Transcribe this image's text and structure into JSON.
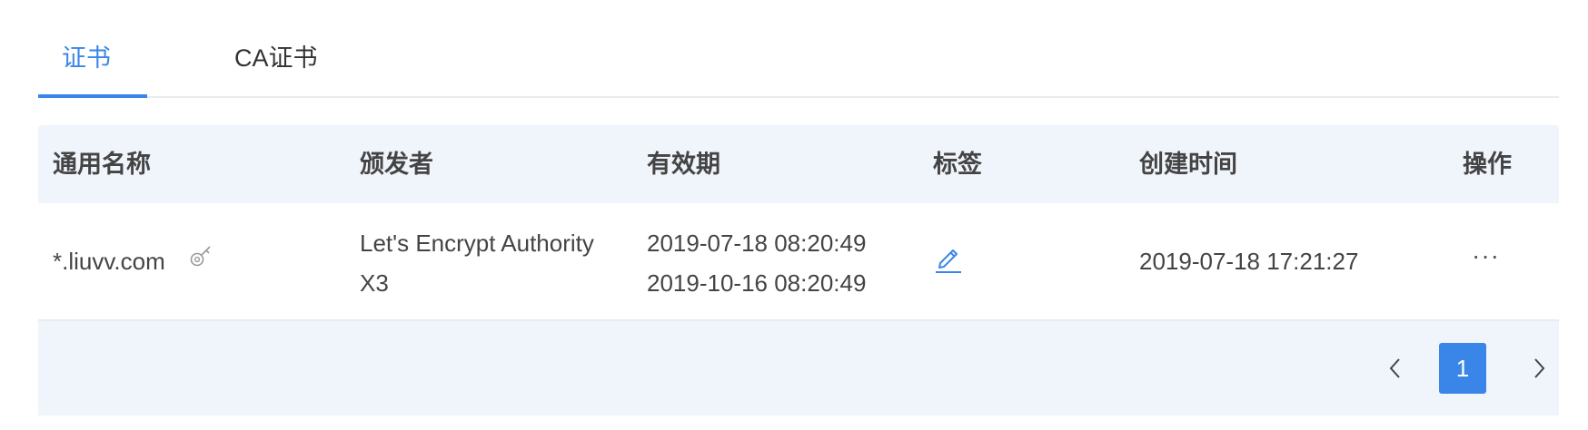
{
  "tabs": [
    {
      "label": "证书",
      "active": true
    },
    {
      "label": "CA证书",
      "active": false
    }
  ],
  "table": {
    "columns": [
      "通用名称",
      "颁发者",
      "有效期",
      "标签",
      "创建时间",
      "操作"
    ],
    "rows": [
      {
        "common_name": "*.liuvv.com",
        "issuer": "Let's Encrypt Authority X3",
        "valid_from": "2019-07-18 08:20:49",
        "valid_to": "2019-10-16 08:20:49",
        "tag_icon": "edit-pencil-icon",
        "created": "2019-07-18 17:21:27",
        "ops": "···"
      }
    ]
  },
  "pagination": {
    "current_page": "1",
    "prev_icon": "chevron-left-icon",
    "next_icon": "chevron-right-icon"
  },
  "colors": {
    "accent": "#3a86e8",
    "header_bg": "#f0f4fb",
    "text": "#444444"
  }
}
